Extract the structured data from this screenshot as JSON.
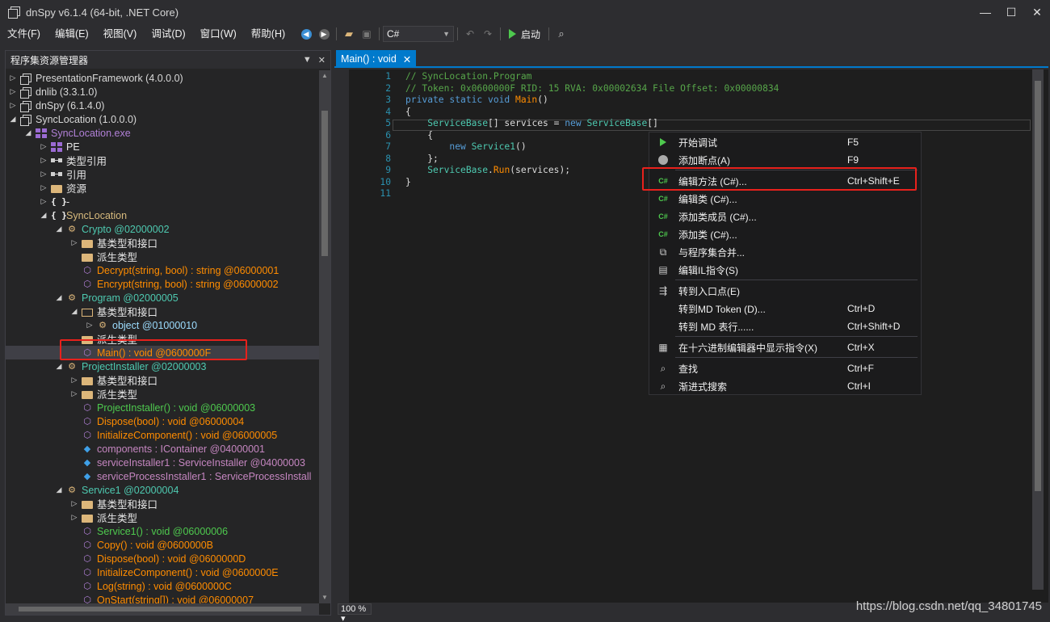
{
  "window": {
    "title": "dnSpy v6.1.4 (64-bit, .NET Core)"
  },
  "menu": [
    "文件(F)",
    "编辑(E)",
    "视图(V)",
    "调试(D)",
    "窗口(W)",
    "帮助(H)"
  ],
  "toolbar": {
    "language": "C#",
    "start_label": "启动"
  },
  "left_panel": {
    "title": "程序集资源管理器",
    "tree": [
      {
        "arrow": "▷",
        "icon": "asm",
        "text": "PresentationFramework (4.0.0.0)",
        "color": "c-asm",
        "indent": 0
      },
      {
        "arrow": "▷",
        "icon": "asm",
        "text": "dnlib (3.3.1.0)",
        "color": "c-asm",
        "indent": 0
      },
      {
        "arrow": "▷",
        "icon": "asm",
        "text": "dnSpy (6.1.4.0)",
        "color": "c-asm",
        "indent": 0
      },
      {
        "arrow": "◢",
        "icon": "asm",
        "text": "SyncLocation (1.0.0.0)",
        "color": "c-asm",
        "indent": 0
      },
      {
        "arrow": "◢",
        "icon": "module",
        "text": "SyncLocation.exe",
        "color": "c-purple",
        "indent": 1
      },
      {
        "arrow": "▷",
        "icon": "module",
        "text": "PE",
        "color": "c-white",
        "indent": 2
      },
      {
        "arrow": "▷",
        "icon": "ref",
        "text": "类型引用",
        "color": "c-white",
        "indent": 2
      },
      {
        "arrow": "▷",
        "icon": "ref",
        "text": "引用",
        "color": "c-white",
        "indent": 2
      },
      {
        "arrow": "▷",
        "icon": "folder",
        "text": "资源",
        "color": "c-white",
        "indent": 2
      },
      {
        "arrow": "▷",
        "icon": "ns",
        "text": "-",
        "color": "c-white",
        "indent": 2
      },
      {
        "arrow": "◢",
        "icon": "ns",
        "text": "SyncLocation",
        "color": "c-yellow",
        "indent": 2
      },
      {
        "arrow": "◢",
        "icon": "cls",
        "text": "Crypto @02000002",
        "color": "c-class",
        "indent": 3
      },
      {
        "arrow": "▷",
        "icon": "folder",
        "text": "基类型和接口",
        "color": "c-white",
        "indent": 4
      },
      {
        "arrow": "",
        "icon": "folder",
        "text": "派生类型",
        "color": "c-white",
        "indent": 4
      },
      {
        "arrow": "",
        "icon": "method",
        "text": "Decrypt(string, bool) : string @06000001",
        "color": "c-orange",
        "indent": 4
      },
      {
        "arrow": "",
        "icon": "method",
        "text": "Encrypt(string, bool) : string @06000002",
        "color": "c-orange",
        "indent": 4
      },
      {
        "arrow": "◢",
        "icon": "cls",
        "text": "Program @02000005",
        "color": "c-class",
        "indent": 3
      },
      {
        "arrow": "◢",
        "icon": "folder-open",
        "text": "基类型和接口",
        "color": "c-white",
        "indent": 4
      },
      {
        "arrow": "▷",
        "icon": "cls",
        "text": "object @01000010",
        "color": "c-typename",
        "indent": 5
      },
      {
        "arrow": "",
        "icon": "folder",
        "text": "派生类型",
        "color": "c-white",
        "indent": 4
      },
      {
        "arrow": "",
        "icon": "method",
        "text": "Main() : void @0600000F",
        "color": "c-orange",
        "indent": 4,
        "selected": true
      },
      {
        "arrow": "◢",
        "icon": "cls",
        "text": "ProjectInstaller @02000003",
        "color": "c-class",
        "indent": 3
      },
      {
        "arrow": "▷",
        "icon": "folder",
        "text": "基类型和接口",
        "color": "c-white",
        "indent": 4
      },
      {
        "arrow": "▷",
        "icon": "folder",
        "text": "派生类型",
        "color": "c-white",
        "indent": 4
      },
      {
        "arrow": "",
        "icon": "method",
        "text": "ProjectInstaller() : void @06000003",
        "color": "c-green",
        "indent": 4
      },
      {
        "arrow": "",
        "icon": "method",
        "text": "Dispose(bool) : void @06000004",
        "color": "c-orange",
        "indent": 4
      },
      {
        "arrow": "",
        "icon": "method",
        "text": "InitializeComponent() : void @06000005",
        "color": "c-orange",
        "indent": 4
      },
      {
        "arrow": "",
        "icon": "field",
        "text": "components : IContainer @04000001",
        "color": "c-field",
        "indent": 4
      },
      {
        "arrow": "",
        "icon": "field",
        "text": "serviceInstaller1 : ServiceInstaller @04000003",
        "color": "c-field",
        "indent": 4
      },
      {
        "arrow": "",
        "icon": "field",
        "text": "serviceProcessInstaller1 : ServiceProcessInstall",
        "color": "c-field",
        "indent": 4
      },
      {
        "arrow": "◢",
        "icon": "cls",
        "text": "Service1 @02000004",
        "color": "c-class",
        "indent": 3
      },
      {
        "arrow": "▷",
        "icon": "folder",
        "text": "基类型和接口",
        "color": "c-white",
        "indent": 4
      },
      {
        "arrow": "▷",
        "icon": "folder",
        "text": "派生类型",
        "color": "c-white",
        "indent": 4
      },
      {
        "arrow": "",
        "icon": "method",
        "text": "Service1() : void @06000006",
        "color": "c-green",
        "indent": 4
      },
      {
        "arrow": "",
        "icon": "method",
        "text": "Copy() : void @0600000B",
        "color": "c-orange",
        "indent": 4
      },
      {
        "arrow": "",
        "icon": "method",
        "text": "Dispose(bool) : void @0600000D",
        "color": "c-orange",
        "indent": 4
      },
      {
        "arrow": "",
        "icon": "method",
        "text": "InitializeComponent() : void @0600000E",
        "color": "c-orange",
        "indent": 4
      },
      {
        "arrow": "",
        "icon": "method",
        "text": "Log(string) : void @0600000C",
        "color": "c-orange",
        "indent": 4
      },
      {
        "arrow": "",
        "icon": "method",
        "text": "OnStart(string[]) : void @06000007",
        "color": "c-orange",
        "indent": 4
      }
    ]
  },
  "editor": {
    "tab_label": "Main() : void",
    "zoom": "100 %",
    "lines": [
      {
        "n": "1",
        "parts": [
          [
            "cm",
            "// SyncLocation.Program"
          ]
        ]
      },
      {
        "n": "2",
        "parts": [
          [
            "cm",
            "// Token: 0x0600000F RID: 15 RVA: 0x00002634 File Offset: 0x00000834"
          ]
        ]
      },
      {
        "n": "3",
        "parts": [
          [
            "kw",
            "private static void "
          ],
          [
            "me",
            "Main"
          ],
          [
            "pl",
            "()"
          ]
        ]
      },
      {
        "n": "4",
        "parts": [
          [
            "pl",
            "{"
          ]
        ]
      },
      {
        "n": "5",
        "parts": [
          [
            "ty",
            "    ServiceBase"
          ],
          [
            "pl",
            "[] services = "
          ],
          [
            "kw",
            "new "
          ],
          [
            "ty",
            "ServiceBase"
          ],
          [
            "pl",
            "[]"
          ]
        ]
      },
      {
        "n": "6",
        "parts": [
          [
            "pl",
            "    {"
          ]
        ]
      },
      {
        "n": "7",
        "parts": [
          [
            "kw",
            "        new "
          ],
          [
            "ty",
            "Service1"
          ],
          [
            "pl",
            "()"
          ]
        ]
      },
      {
        "n": "8",
        "parts": [
          [
            "pl",
            "    };"
          ]
        ]
      },
      {
        "n": "9",
        "parts": [
          [
            "ty",
            "    ServiceBase"
          ],
          [
            "pl",
            "."
          ],
          [
            "me",
            "Run"
          ],
          [
            "pl",
            "(services);"
          ]
        ]
      },
      {
        "n": "10",
        "parts": [
          [
            "pl",
            "}"
          ]
        ]
      },
      {
        "n": "11",
        "parts": []
      }
    ]
  },
  "context_menu": {
    "items": [
      {
        "icon": "play",
        "label": "开始调试",
        "key": "F5"
      },
      {
        "icon": "dot",
        "label": "添加断点(A)",
        "key": "F9"
      },
      {
        "sep": true
      },
      {
        "icon": "csharp",
        "label": "编辑方法 (C#)...",
        "key": "Ctrl+Shift+E"
      },
      {
        "icon": "csharp",
        "label": "编辑类 (C#)...",
        "key": ""
      },
      {
        "icon": "csharp",
        "label": "添加类成员 (C#)...",
        "key": ""
      },
      {
        "icon": "csharp",
        "label": "添加类 (C#)...",
        "key": ""
      },
      {
        "icon": "merge",
        "label": "与程序集合并...",
        "key": ""
      },
      {
        "icon": "il",
        "label": "编辑IL指令(S)",
        "key": ""
      },
      {
        "sep": true
      },
      {
        "icon": "entry",
        "label": "转到入口点(E)",
        "key": ""
      },
      {
        "icon": "",
        "label": "转到MD Token (D)...",
        "key": "Ctrl+D"
      },
      {
        "icon": "",
        "label": "转到 MD 表行......",
        "key": "Ctrl+Shift+D"
      },
      {
        "sep": true
      },
      {
        "icon": "hex",
        "label": "在十六进制编辑器中显示指令(X)",
        "key": "Ctrl+X"
      },
      {
        "sep": true
      },
      {
        "icon": "search",
        "label": "查找",
        "key": "Ctrl+F"
      },
      {
        "icon": "search",
        "label": "渐进式搜索",
        "key": "Ctrl+I"
      }
    ]
  },
  "watermark": "https://blog.csdn.net/qq_34801745"
}
